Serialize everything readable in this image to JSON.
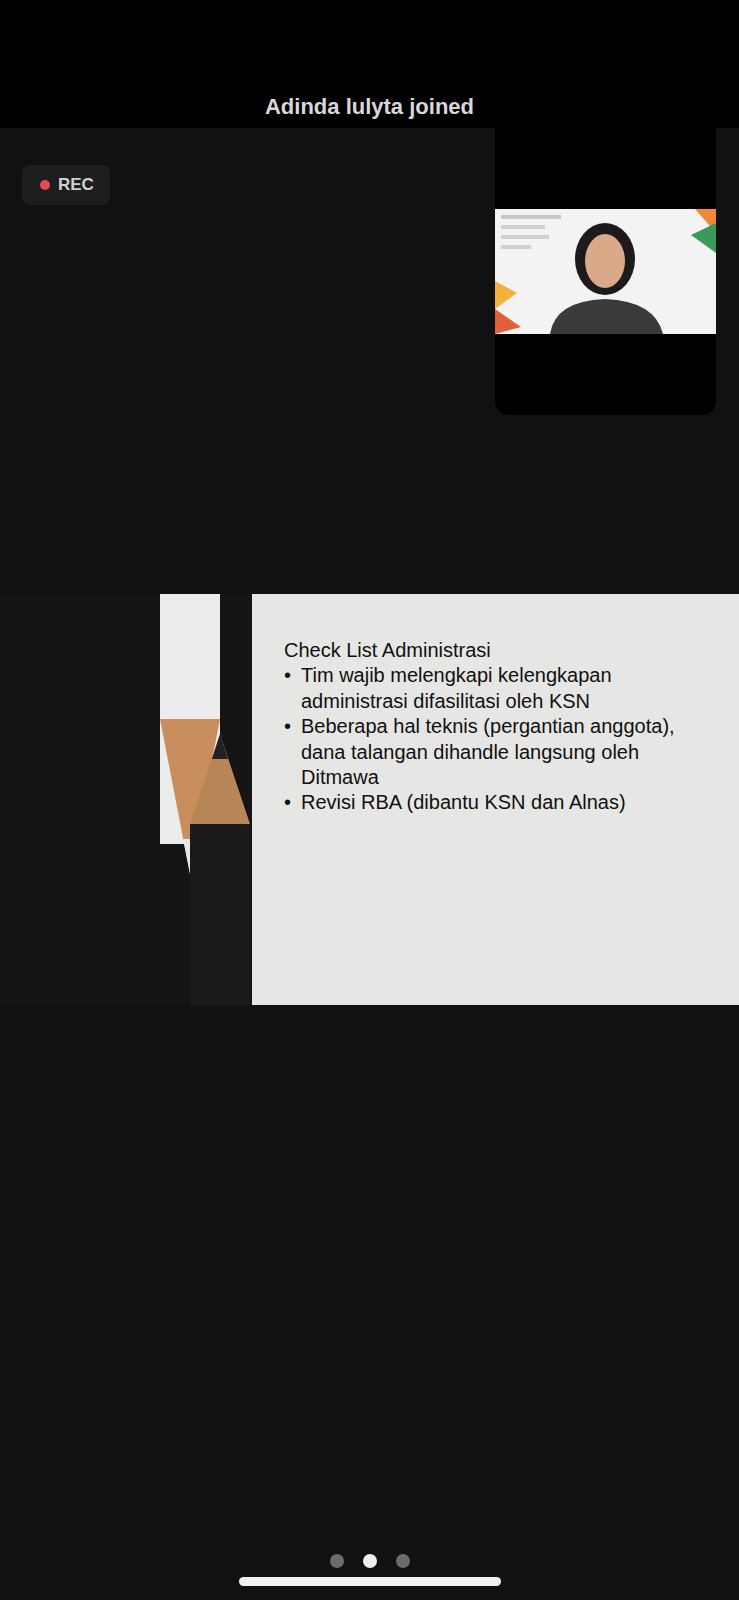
{
  "notification": "Adinda lulyta joined",
  "recording": {
    "label": "REC"
  },
  "slide": {
    "title": "Check List Administrasi",
    "bullets": [
      "Tim wajib melengkapi kelengkapan administrasi difasilitasi oleh KSN",
      "Beberapa hal teknis (pergantian anggota), dana talangan dihandle langsung oleh Ditmawa",
      "Revisi RBA (dibantu KSN dan Alnas)"
    ],
    "bullet_mark": "•"
  },
  "pages": [
    {
      "selected": false
    },
    {
      "selected": true
    },
    {
      "selected": false
    }
  ]
}
